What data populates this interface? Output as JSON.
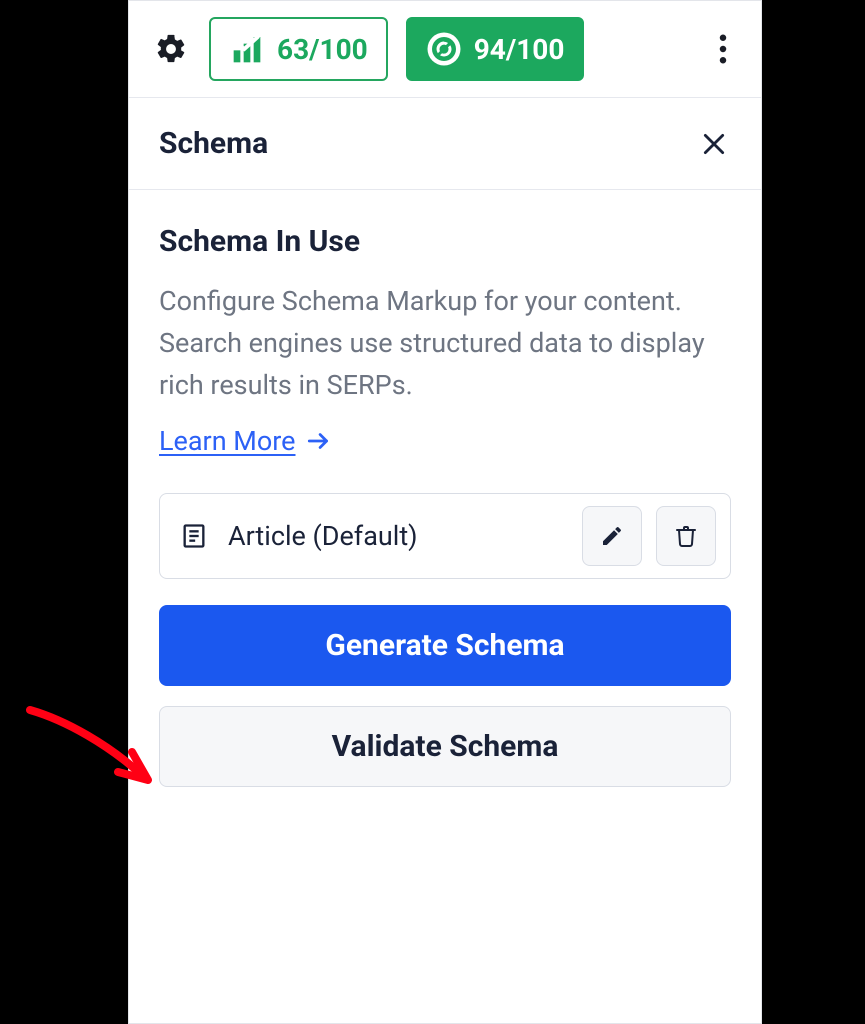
{
  "header": {
    "score1": "63/100",
    "score2": "94/100"
  },
  "titlebar": {
    "title": "Schema"
  },
  "section": {
    "title": "Schema In Use",
    "description": "Configure Schema Markup for your content. Search engines use structured data to display rich results in SERPs.",
    "learn_more": "Learn More"
  },
  "schema_row": {
    "name": "Article (Default)"
  },
  "buttons": {
    "generate": "Generate Schema",
    "validate": "Validate Schema"
  },
  "colors": {
    "accent_green": "#1ca85e",
    "accent_blue": "#1b58ef",
    "link_blue": "#2c61f6",
    "text_dark": "#1a2238",
    "text_muted": "#6e7582"
  }
}
